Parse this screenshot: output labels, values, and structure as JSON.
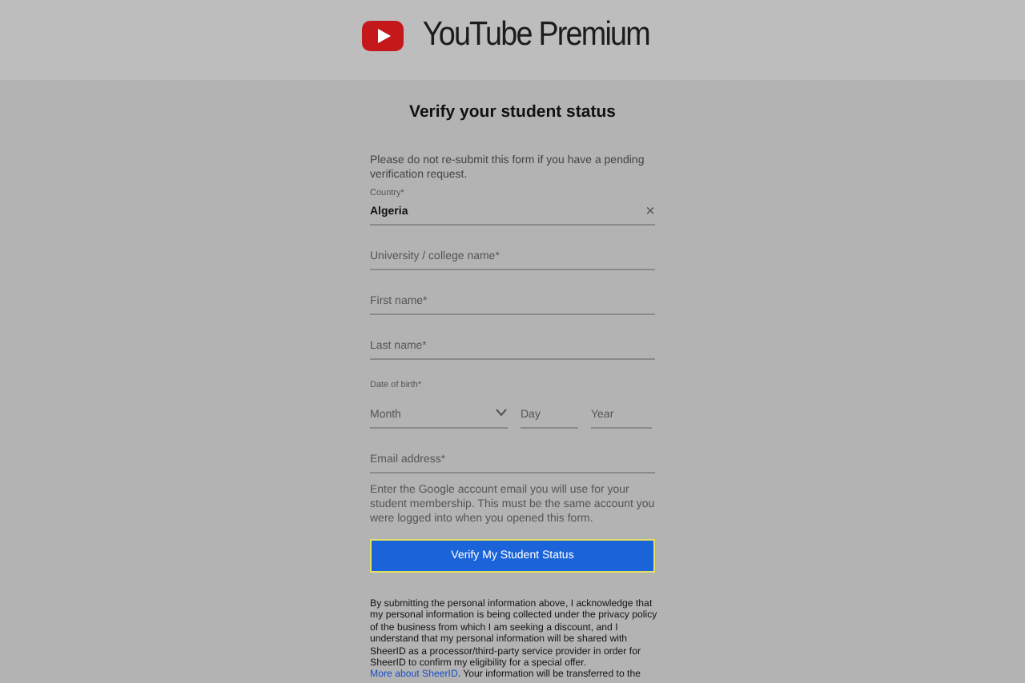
{
  "header": {
    "logo_text": "YouTube Premium"
  },
  "form": {
    "title": "Verify your student status",
    "notice": "Please do not re-submit this form if you have a pending verification request.",
    "fields": [
      {
        "kind": "select",
        "label": "Country*",
        "value": "Algeria",
        "clear_icon": "×"
      },
      {
        "kind": "text",
        "placeholder": "University / college name*"
      },
      {
        "kind": "text",
        "placeholder": "First name*"
      },
      {
        "kind": "text",
        "placeholder": "Last name*"
      },
      {
        "kind": "date",
        "label": "Date of birth*",
        "parts": [
          {
            "placeholder": "Month",
            "dropdown": true
          },
          {
            "placeholder": "Day",
            "dropdown": false
          },
          {
            "placeholder": "Year",
            "dropdown": false
          }
        ]
      },
      {
        "kind": "text",
        "placeholder": "Email address*"
      }
    ],
    "email_help": "Enter the Google account email you will use for your student membership. This must be the same account you were logged into when you opened this form.",
    "submit": "Verify My Student Status",
    "disclaimer": {
      "before": "By submitting the personal information above, I acknowledge that my personal information is being collected under the privacy policy of the business from which I am seeking a discount, and I understand that my personal information will be shared with SheerID as a processor/third-party service provider in order for SheerID to confirm my eligibility for a special offer.",
      "link": "More about SheerID",
      "after": ". Your information will be transferred to the"
    }
  }
}
